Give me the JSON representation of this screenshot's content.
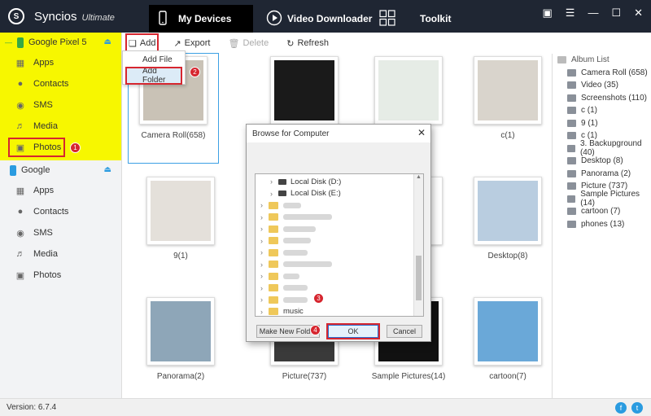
{
  "app": {
    "title": "Syncios",
    "edition": "Ultimate",
    "logo_icon": "syncios-logo-icon"
  },
  "topnav": [
    {
      "label": "My Devices",
      "icon": "phone-icon",
      "active": true
    },
    {
      "label": "Video Downloader",
      "icon": "play-icon",
      "active": false
    },
    {
      "label": "Toolkit",
      "icon": "grid-icon",
      "active": false
    }
  ],
  "window_icons": [
    "chat-icon",
    "menu-icon",
    "minimize-icon",
    "maximize-icon",
    "close-icon"
  ],
  "devices": [
    {
      "name": "Google Pixel 5",
      "phone_color": "#35a845",
      "highlighted": true,
      "items": [
        {
          "label": "Apps",
          "icon": "apps-icon"
        },
        {
          "label": "Contacts",
          "icon": "contacts-icon"
        },
        {
          "label": "SMS",
          "icon": "sms-icon"
        },
        {
          "label": "Media",
          "icon": "media-icon"
        },
        {
          "label": "Photos",
          "icon": "photos-icon"
        }
      ]
    },
    {
      "name": "Google",
      "phone_color": "#2a9be0",
      "highlighted": false,
      "items": [
        {
          "label": "Apps",
          "icon": "apps-icon"
        },
        {
          "label": "Contacts",
          "icon": "contacts-icon"
        },
        {
          "label": "SMS",
          "icon": "sms-icon"
        },
        {
          "label": "Media",
          "icon": "media-icon"
        },
        {
          "label": "Photos",
          "icon": "photos-icon"
        }
      ]
    }
  ],
  "toolbar": {
    "add": "Add",
    "export": "Export",
    "delete": "Delete",
    "refresh": "Refresh"
  },
  "add_menu": {
    "add_file": "Add File",
    "add_folder": "Add Folder"
  },
  "albums_grid": [
    {
      "label": "Camera Roll(658)",
      "fill": "#c9c2b6",
      "selected": true
    },
    {
      "label": "",
      "fill": "#1a1a1a",
      "selected": false
    },
    {
      "label": "",
      "fill": "#e6ece6",
      "selected": false
    },
    {
      "label": "c(1)",
      "fill": "#d9d4cc",
      "selected": false
    },
    {
      "label": "9(1)",
      "fill": "#e4e0da",
      "selected": false
    },
    {
      "label": "",
      "fill": "#ffffff",
      "selected": false
    },
    {
      "label": "",
      "fill": "#ffffff",
      "selected": false
    },
    {
      "label": "Desktop(8)",
      "fill": "#b9cde0",
      "selected": false
    },
    {
      "label": "Panorama(2)",
      "fill": "#8ea6b8",
      "selected": false
    },
    {
      "label": "Picture(737)",
      "fill": "#3a3a3a",
      "selected": false
    },
    {
      "label": "Sample Pictures(14)",
      "fill": "#111111",
      "selected": false
    },
    {
      "label": "cartoon(7)",
      "fill": "#6aa8d8",
      "selected": false
    }
  ],
  "album_list": {
    "header": "Album List",
    "items": [
      "Camera Roll (658)",
      "Video (35)",
      "Screenshots (110)",
      "c (1)",
      "9 (1)",
      "c (1)",
      "3. Backupground (40)",
      "Desktop (8)",
      "Panorama (2)",
      "Picture (737)",
      "Sample Pictures (14)",
      "cartoon (7)",
      "phones (13)"
    ]
  },
  "dialog": {
    "title": "Browse for Computer",
    "tree": [
      {
        "label": "Local Disk (D:)",
        "type": "drive"
      },
      {
        "label": "Local Disk (E:)",
        "type": "drive"
      },
      {
        "label": "",
        "type": "blur"
      },
      {
        "label": "",
        "type": "blur"
      },
      {
        "label": "",
        "type": "blur"
      },
      {
        "label": "",
        "type": "blur"
      },
      {
        "label": "",
        "type": "blur"
      },
      {
        "label": "",
        "type": "blur"
      },
      {
        "label": "",
        "type": "blur"
      },
      {
        "label": "",
        "type": "blur"
      },
      {
        "label": "",
        "type": "blur"
      },
      {
        "label": "music",
        "type": "folder"
      },
      {
        "label": "photos",
        "type": "folder",
        "selected": true
      }
    ],
    "make_new_folder": "Make New Folder",
    "ok": "OK",
    "cancel": "Cancel"
  },
  "steps": [
    "1",
    "2",
    "3",
    "4"
  ],
  "status": {
    "version": "Version: 6.7.4"
  },
  "social": [
    {
      "icon": "facebook-icon",
      "glyph": "f"
    },
    {
      "icon": "twitter-icon",
      "glyph": "t"
    }
  ],
  "colors": {
    "accent": "#2a9be0",
    "highlight": "#f7f700",
    "annotation": "#d6262f",
    "titlebar": "#1f2633"
  }
}
